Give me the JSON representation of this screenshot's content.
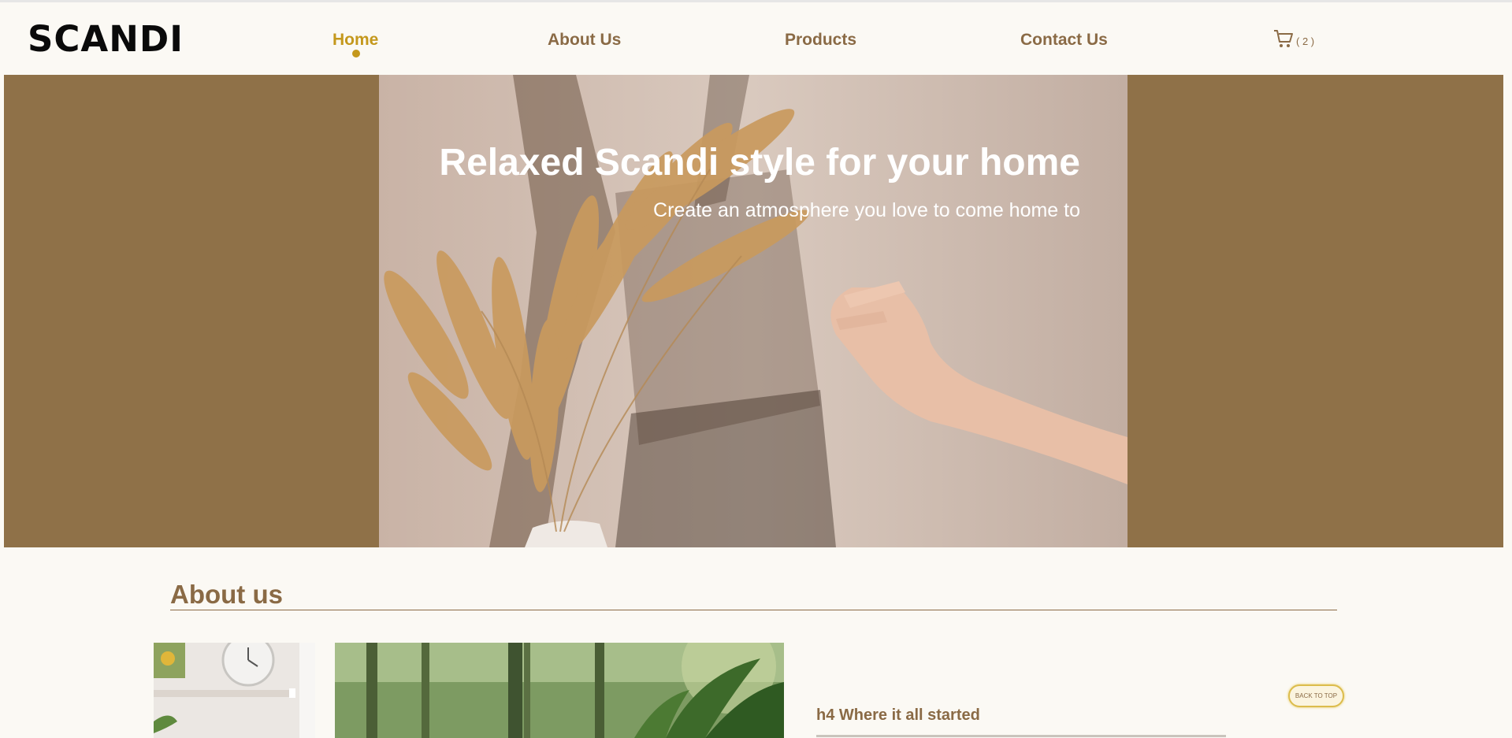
{
  "site": {
    "logo": "SCANDI"
  },
  "nav": {
    "items": [
      {
        "label": "Home"
      },
      {
        "label": "About Us"
      },
      {
        "label": "Products"
      },
      {
        "label": "Contact Us"
      }
    ],
    "cart_count": "( 2 )"
  },
  "hero": {
    "title": "Relaxed Scandi style for your home",
    "subtitle": "Create an atmosphere you love to come home to"
  },
  "about": {
    "heading": "About us",
    "subheading": "h4 Where it all started"
  },
  "back_to_top": "BACK TO TOP",
  "colors": {
    "accent": "#c4981c",
    "brown": "#8a6a45",
    "hero_band": "#8f7148",
    "background": "#fbf9f4"
  }
}
